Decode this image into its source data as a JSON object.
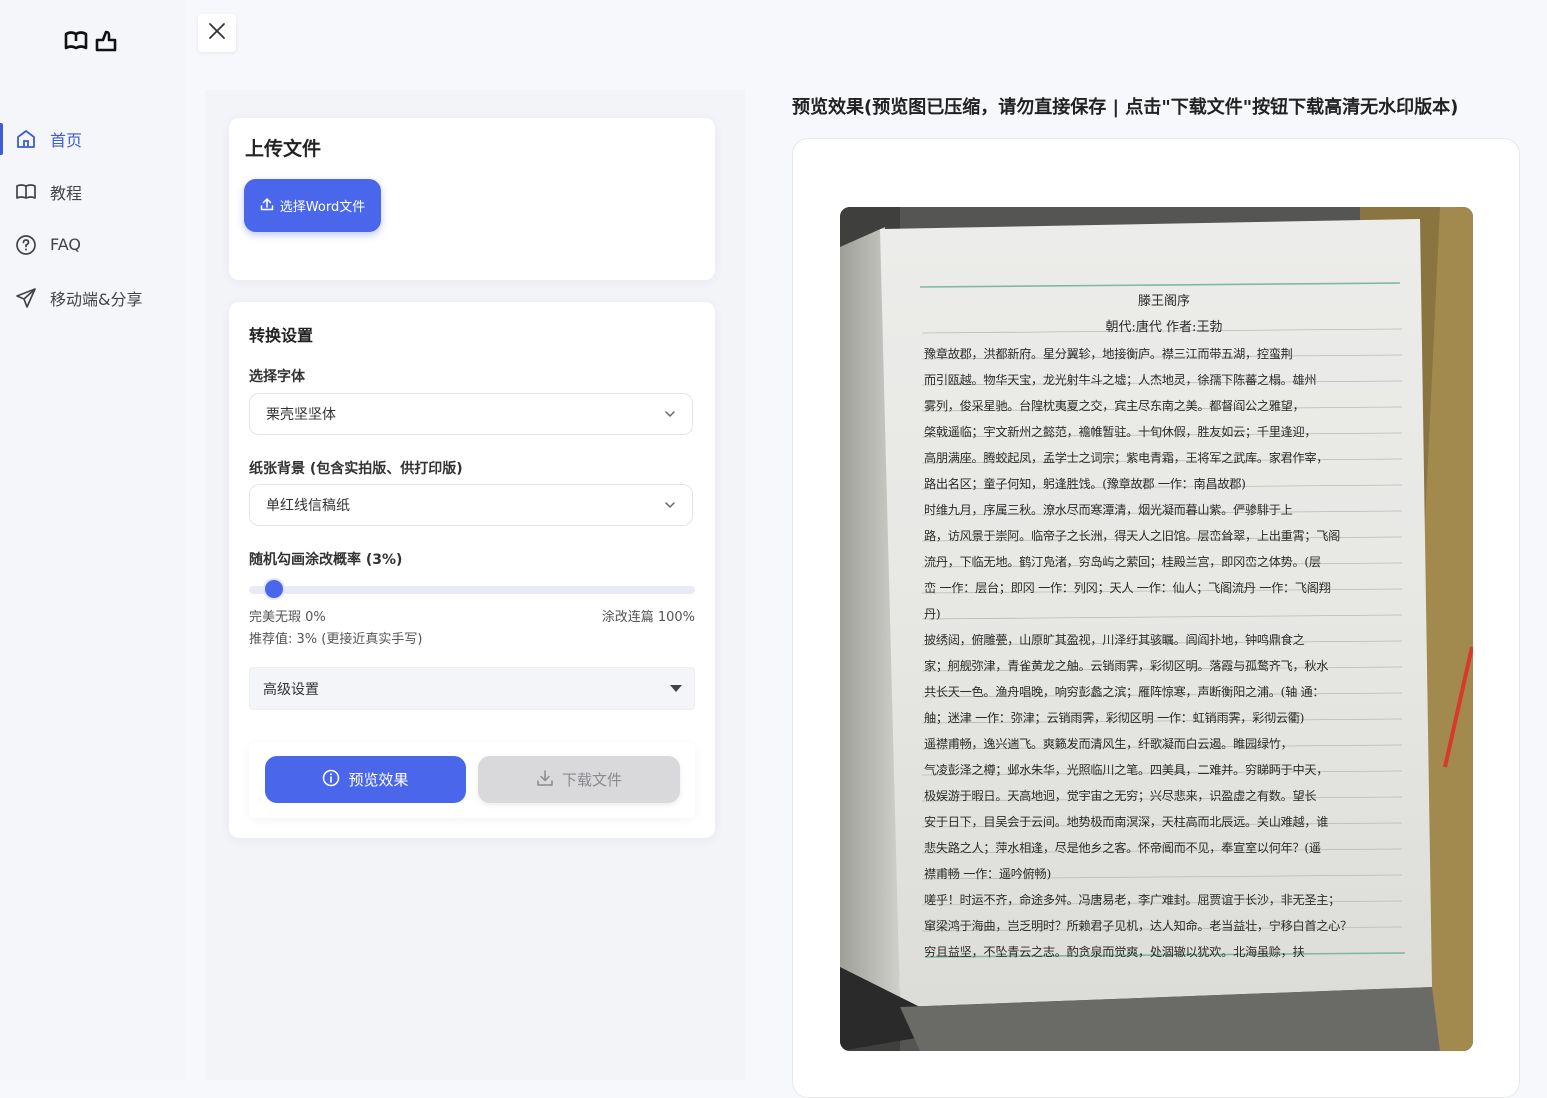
{
  "sidebar": {
    "logo_icons": [
      "book-open-icon",
      "thumbs-up-icon"
    ],
    "items": [
      {
        "label": "首页",
        "icon": "home-icon",
        "active": true
      },
      {
        "label": "教程",
        "icon": "book-icon",
        "active": false
      },
      {
        "label": "FAQ",
        "icon": "question-circle-icon",
        "active": false
      },
      {
        "label": "移动端&分享",
        "icon": "send-icon",
        "active": false
      }
    ]
  },
  "header": {
    "close_icon": "close-icon"
  },
  "upload": {
    "title": "上传文件",
    "button_label": "选择Word文件"
  },
  "settings": {
    "title": "转换设置",
    "font_label": "选择字体",
    "font_value": "栗壳坚坚体",
    "paper_label": "纸张背景 (包含实拍版、供打印版)",
    "paper_value": "单红线信稿纸",
    "prob_label": "随机勾画涂改概率 (3%)",
    "prob_value": 0.03,
    "min_label": "完美无瑕 0%",
    "max_label": "涂改连篇 100%",
    "recommend": "推荐值: 3% (更接近真实手写)",
    "advanced_label": "高级设置"
  },
  "actions": {
    "preview_label": "预览效果",
    "download_label": "下载文件"
  },
  "preview": {
    "title": "预览效果(预览图已压缩，请勿直接保存 | 点击\"下载文件\"按钮下载高清无水印版本)",
    "doc_title": "滕王阁序",
    "doc_author": "朝代:唐代 作者:王勃",
    "doc_lines": [
      "豫章故郡，洪都新府。星分翼轸，地接衡庐。襟三江而带五湖，控蛮荆",
      "而引瓯越。物华天宝，龙光射牛斗之墟；人杰地灵，徐孺下陈蕃之榻。雄州",
      "雾列，俊采星驰。台隍枕夷夏之交，宾主尽东南之美。都督阎公之雅望，",
      "棨戟遥临；宇文新州之懿范，襜帷暂驻。十旬休假，胜友如云；千里逢迎，",
      "高朋满座。腾蛟起凤，孟学士之词宗；紫电青霜，王将军之武库。家君作宰，",
      "路出名区；童子何知，躬逢胜饯。(豫章故郡 一作：南昌故郡)",
      "时维九月，序属三秋。潦水尽而寒潭清，烟光凝而暮山紫。俨骖騑于上",
      "路，访风景于崇阿。临帝子之长洲，得天人之旧馆。层峦耸翠，上出重霄；飞阁",
      "流丹，下临无地。鹤汀凫渚，穷岛屿之萦回；桂殿兰宫，即冈峦之体势。(层",
      "峦 一作：层台；即冈 一作：列冈；天人 一作：仙人；飞阁流丹 一作：飞阁翔",
      "丹)",
      "披绣闼，俯雕甍，山原旷其盈视，川泽纡其骇瞩。闾阎扑地，钟鸣鼎食之",
      "家；舸舰弥津，青雀黄龙之舳。云销雨霁，彩彻区明。落霞与孤鹜齐飞，秋水",
      "共长天一色。渔舟唱晚，响穷彭蠡之滨；雁阵惊寒，声断衡阳之浦。(轴 通：",
      "舳；迷津 一作：弥津；云销雨霁，彩彻区明 一作：虹销雨霁，彩彻云衢)",
      "遥襟甫畅，逸兴遄飞。爽籁发而清风生，纤歌凝而白云遏。睢园绿竹，",
      "气凌彭泽之樽；邺水朱华，光照临川之笔。四美具，二难并。穷睇眄于中天，",
      "极娱游于暇日。天高地迥，觉宇宙之无穷；兴尽悲来，识盈虚之有数。望长",
      "安于日下，目吴会于云间。地势极而南溟深，天柱高而北辰远。关山难越，谁",
      "悲失路之人；萍水相逢，尽是他乡之客。怀帝阍而不见，奉宣室以何年？(遥",
      "襟甫畅 一作：遥吟俯畅)",
      "嗟乎！时运不齐，命途多舛。冯唐易老，李广难封。屈贾谊于长沙，非无圣主；",
      "窜梁鸿于海曲，岂乏明时？所赖君子见机，达人知命。老当益壮，宁移白首之心？",
      "穷且益坚，不坠青云之志。酌贪泉而觉爽，处涸辙以犹欢。北海虽赊，扶"
    ]
  }
}
